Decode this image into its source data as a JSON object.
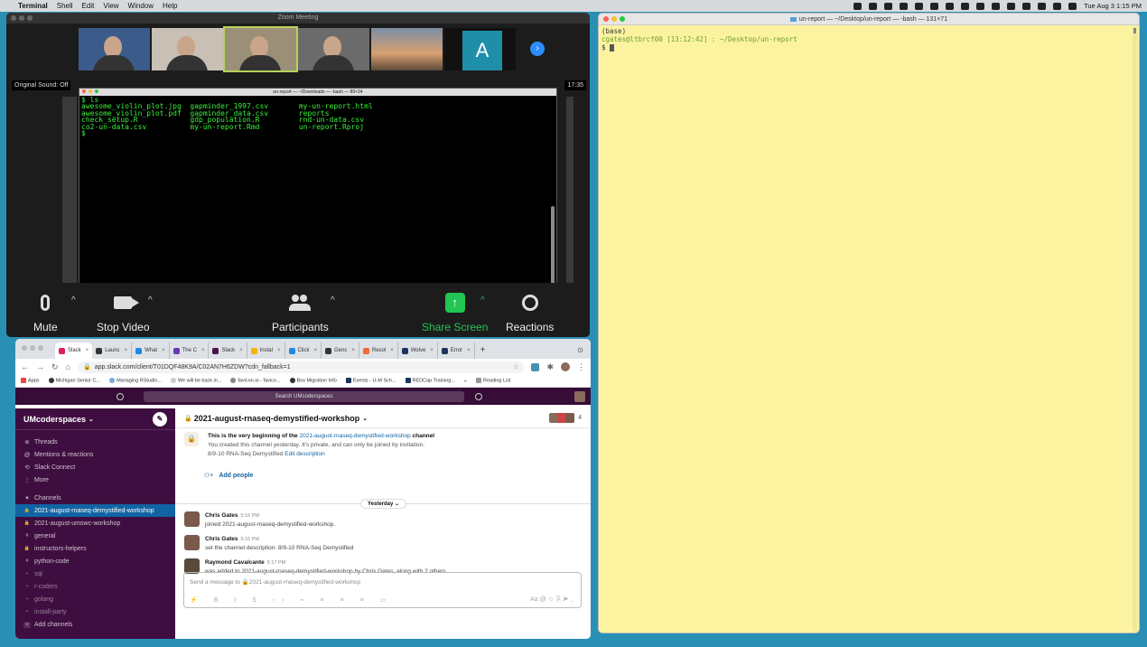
{
  "menubar": {
    "app": "Terminal",
    "items": [
      "Shell",
      "Edit",
      "View",
      "Window",
      "Help"
    ],
    "clock": "Tue Aug 3  1:15 PM"
  },
  "zoom": {
    "title": "Zoom Meeting",
    "avatar_letter": "A",
    "original_sound": "Original Sound: Off",
    "timer": "17:35",
    "controls": {
      "mute": "Mute",
      "stop_video": "Stop Video",
      "participants": "Participants",
      "share_screen": "Share Screen",
      "reactions": "Reactions"
    },
    "shared_terminal": {
      "title": "un-report — ~/Downloads — -bash — 89×34",
      "lines": [
        "$ ls",
        "awesome_violin_plot.jpg  gapminder_1997.csv       my-un-report.html",
        "awesome_violin_plot.pdf  gapminder_data.csv       reports",
        "check_setup.R            gdp_population.R         rnd-un-data.csv",
        "co2-un-data.csv          my-un-report.Rmd         un-report.Rproj",
        "$"
      ]
    }
  },
  "terminal": {
    "title": "un-report — ~/Desktop/un-report — -bash — 131×71",
    "line1": "(base)",
    "prompt_user": "cgates@ltbrcf00 [13:12:42] : ~/Desktop/un-report",
    "prompt_symbol": "$"
  },
  "chrome": {
    "tabs": [
      {
        "label": "Slack",
        "color": "#e01e5a",
        "active": true
      },
      {
        "label": "Launc",
        "color": "#333"
      },
      {
        "label": "What",
        "color": "#1e88e5"
      },
      {
        "label": "The C",
        "color": "#673ab7"
      },
      {
        "label": "Slack",
        "color": "#4a154b"
      },
      {
        "label": "Instal",
        "color": "#f4b400"
      },
      {
        "label": "Click",
        "color": "#1e88e5"
      },
      {
        "label": "Genc",
        "color": "#333"
      },
      {
        "label": "Resol",
        "color": "#f06a35"
      },
      {
        "label": "Wolve",
        "color": "#1b365d"
      },
      {
        "label": "Error",
        "color": "#1b365d"
      }
    ],
    "new_tab": "+",
    "url": "app.slack.com/client/T01DQF48K9A/C02AN7H6ZDW?cdn_fallback=1",
    "bookmarks": [
      "Apps",
      "Michigan Senior C...",
      "Managing RStudio...",
      "We will be back in...",
      "favicon.io - favico...",
      "Box Migration Info",
      "Events - U-M Sch...",
      "REDCap Training...",
      "»",
      "Reading List"
    ]
  },
  "slack": {
    "search_placeholder": "Search UMcoderspaces",
    "workspace": "UMcoderspaces",
    "sidebar_top": [
      {
        "sym": "⊜",
        "label": "Threads"
      },
      {
        "sym": "@",
        "label": "Mentions & reactions"
      },
      {
        "sym": "⟲",
        "label": "Slack Connect"
      },
      {
        "sym": "⋮",
        "label": "More"
      }
    ],
    "channels_header": "Channels",
    "channels": [
      {
        "sym": "🔒",
        "label": "2021-august-rnaseq-demystified-workshop",
        "active": true
      },
      {
        "sym": "🔒",
        "label": "2021-august-umswc-workshop"
      },
      {
        "sym": "#",
        "label": "general"
      },
      {
        "sym": "🔒",
        "label": "instructors-helpers"
      },
      {
        "sym": "#",
        "label": "python-code"
      },
      {
        "sym": "+",
        "label": "sql",
        "dim": true
      },
      {
        "sym": "+",
        "label": "r-coders",
        "dim": true
      },
      {
        "sym": "+",
        "label": "golang",
        "dim": true
      },
      {
        "sym": "+",
        "label": "install-party",
        "dim": true
      }
    ],
    "add_channels": "Add channels",
    "channel_name": "2021-august-rnaseq-demystified-workshop",
    "member_count": "4",
    "intro": {
      "line1_a": "This is the very beginning of the",
      "line1_channel": "2021-august-rnaseq-demystified-workshop",
      "line1_b": "channel",
      "line2": "You created this channel yesterday. It's private, and can only be joined by invitation.",
      "line3": "8/9-10 RNA-Seq Demystified",
      "edit": "Edit description"
    },
    "add_people": "Add people",
    "day_divider": "Yesterday",
    "messages": [
      {
        "who": "Chris Gates",
        "time": "5:16 PM",
        "text": "joined 2021-august-rnaseq-demystified-workshop."
      },
      {
        "who": "Chris Gates",
        "time": "5:16 PM",
        "text": "set the channel description: 8/9-10 RNA-Seq Demystified"
      },
      {
        "who": "Raymond Cavalcante",
        "time": "5:17 PM",
        "text": "was added to 2021-august-rnaseq-demystified-workshop by Chris Gates, along with 2 others."
      }
    ],
    "composer_placeholder": "Send a message to 🔒2021-august-rnaseq-demystified-workshop"
  },
  "colors": {
    "desktop": "#2a8fb4",
    "slack_sidebar": "#3f0e40",
    "slack_active": "#1164a3",
    "terminal_bg": "#fcf3a0",
    "zoom_share": "#23c552"
  }
}
